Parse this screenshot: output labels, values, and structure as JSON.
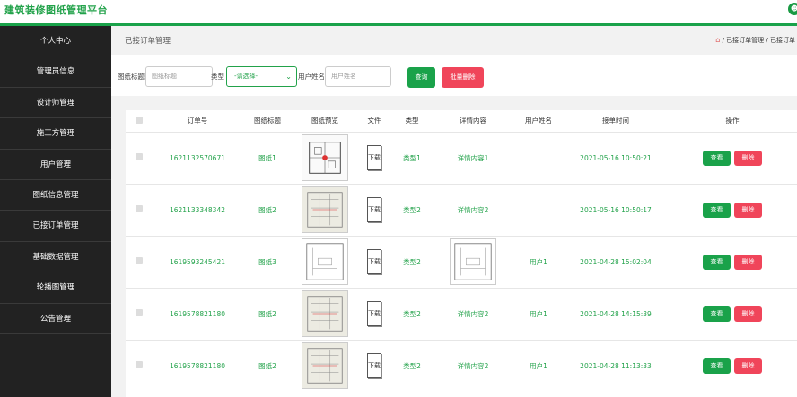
{
  "app": {
    "title": "建筑装修图纸管理平台",
    "avatar_icon": "user-icon"
  },
  "colors": {
    "brand": "#1aa24a",
    "danger": "#f0455a",
    "sidebar": "#222222"
  },
  "sidebar": {
    "items": [
      {
        "label": "个人中心"
      },
      {
        "label": "管理员信息"
      },
      {
        "label": "设计师管理"
      },
      {
        "label": "施工方管理"
      },
      {
        "label": "用户管理"
      },
      {
        "label": "图纸信息管理"
      },
      {
        "label": "已接订单管理"
      },
      {
        "label": "基础数据管理"
      },
      {
        "label": "轮播图管理"
      },
      {
        "label": "公告管理"
      }
    ]
  },
  "page": {
    "title": "已接订单管理",
    "crumb": "/ 已接订单管理 / 已接订单"
  },
  "search": {
    "title_label": "图纸标题",
    "title_placeholder": "图纸标题",
    "type_label": "类型",
    "type_value": "-请选择-",
    "user_label": "用户姓名",
    "user_placeholder": "用户姓名",
    "query_label": "查询",
    "batch_delete_label": "批量删除"
  },
  "table": {
    "headers": [
      "",
      "订单号",
      "图纸标题",
      "图纸预览",
      "文件",
      "类型",
      "详情内容",
      "用户姓名",
      "接单时间",
      "操作"
    ],
    "view_label": "查看",
    "delete_label": "删除",
    "download_label": "下载",
    "rows": [
      {
        "order_no": "1621132570671",
        "title": "图纸1",
        "type": "类型1",
        "detail": "详情内容1",
        "user": "",
        "time": "2021-05-16 10:50:21"
      },
      {
        "order_no": "1621133348342",
        "title": "图纸2",
        "type": "类型2",
        "detail": "详情内容2",
        "user": "",
        "time": "2021-05-16 10:50:17"
      },
      {
        "order_no": "1619593245421",
        "title": "图纸3",
        "type": "类型2",
        "detail": "",
        "user": "用户1",
        "time": "2021-04-28 15:02:04"
      },
      {
        "order_no": "1619578821180",
        "title": "图纸2",
        "type": "类型2",
        "detail": "详情内容2",
        "user": "用户1",
        "time": "2021-04-28 14:15:39"
      },
      {
        "order_no": "1619578821180",
        "title": "图纸2",
        "type": "类型2",
        "detail": "详情内容2",
        "user": "用户1",
        "time": "2021-04-28 11:13:33"
      }
    ]
  }
}
